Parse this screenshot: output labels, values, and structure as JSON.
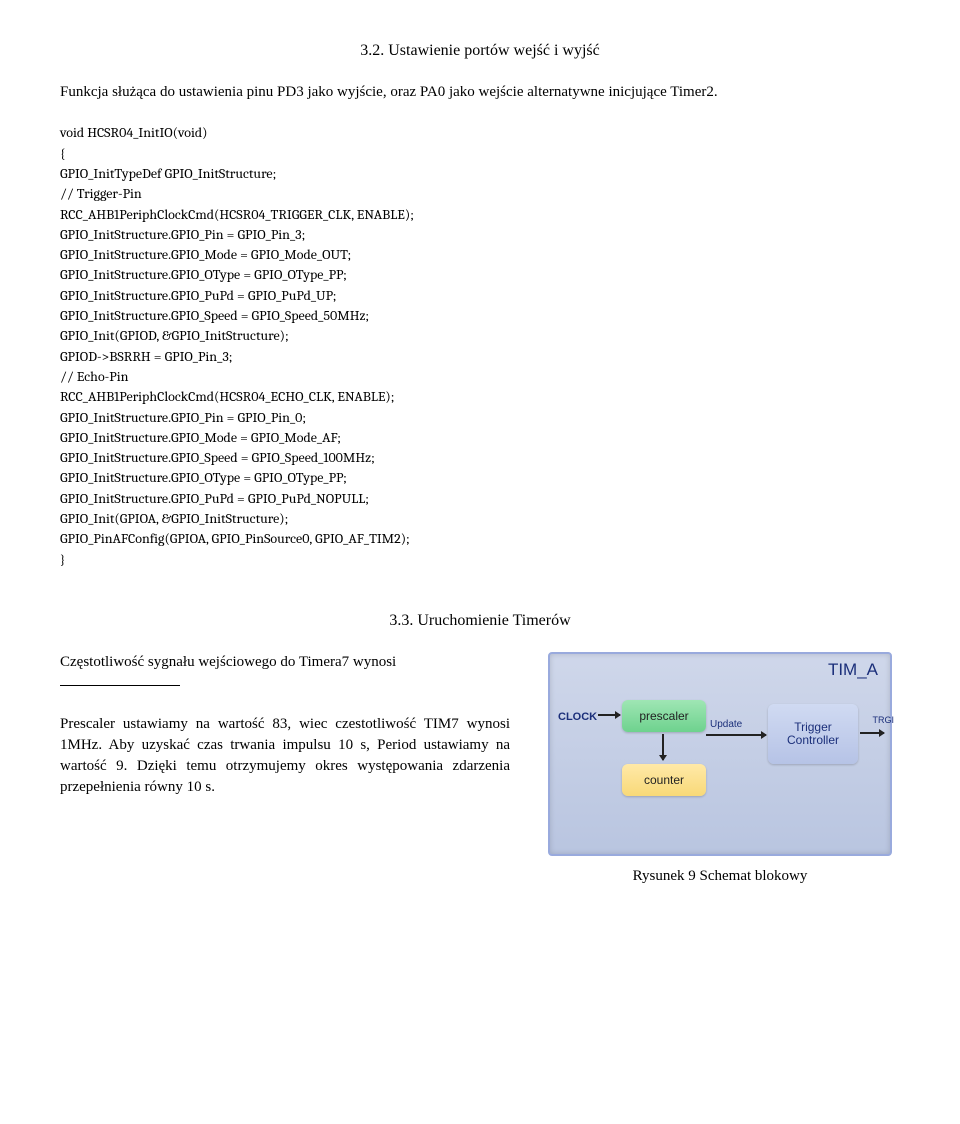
{
  "section32": {
    "title": "3.2. Ustawienie portów wejść i wyjść",
    "intro": "Funkcja służąca do ustawienia pinu PD3 jako wyjście, oraz PA0 jako wejście alternatywne inicjujące Timer2.",
    "code": "void HCSR04_InitIO(void)\n{\nGPIO_InitTypeDef GPIO_InitStructure;\n// Trigger-Pin\nRCC_AHB1PeriphClockCmd(HCSR04_TRIGGER_CLK, ENABLE);\nGPIO_InitStructure.GPIO_Pin = GPIO_Pin_3;\nGPIO_InitStructure.GPIO_Mode = GPIO_Mode_OUT;\nGPIO_InitStructure.GPIO_OType = GPIO_OType_PP;\nGPIO_InitStructure.GPIO_PuPd = GPIO_PuPd_UP;\nGPIO_InitStructure.GPIO_Speed = GPIO_Speed_50MHz;\nGPIO_Init(GPIOD, &GPIO_InitStructure);\nGPIOD->BSRRH = GPIO_Pin_3;\n// Echo-Pin\nRCC_AHB1PeriphClockCmd(HCSR04_ECHO_CLK, ENABLE);\nGPIO_InitStructure.GPIO_Pin = GPIO_Pin_0;\nGPIO_InitStructure.GPIO_Mode = GPIO_Mode_AF;\nGPIO_InitStructure.GPIO_Speed = GPIO_Speed_100MHz;\nGPIO_InitStructure.GPIO_OType = GPIO_OType_PP;\nGPIO_InitStructure.GPIO_PuPd = GPIO_PuPd_NOPULL;\nGPIO_Init(GPIOA, &GPIO_InitStructure);\nGPIO_PinAFConfig(GPIOA, GPIO_PinSource0, GPIO_AF_TIM2);\n}"
  },
  "section33": {
    "title": "3.3. Uruchomienie Timerów",
    "freq_text": "Częstotliwość sygnału wejściowego do Timera7 wynosi",
    "prescaler_text": "Prescaler ustawiamy na wartość 83, wiec czestotliwość TIM7 wynosi 1MHz. Aby uzyskać czas trwania impulsu 10 s, Period ustawiamy na wartość 9. Dzięki temu otrzymujemy okres występowania zdarzenia przepełnienia równy 10 s."
  },
  "diagram": {
    "tim_label": "TIM_A",
    "clock_label": "CLOCK",
    "prescaler_label": "prescaler",
    "counter_label": "counter",
    "update_label": "Update",
    "trigger_label1": "Trigger",
    "trigger_label2": "Controller",
    "trg_label": "TRGI"
  },
  "caption": "Rysunek 9 Schemat blokowy"
}
